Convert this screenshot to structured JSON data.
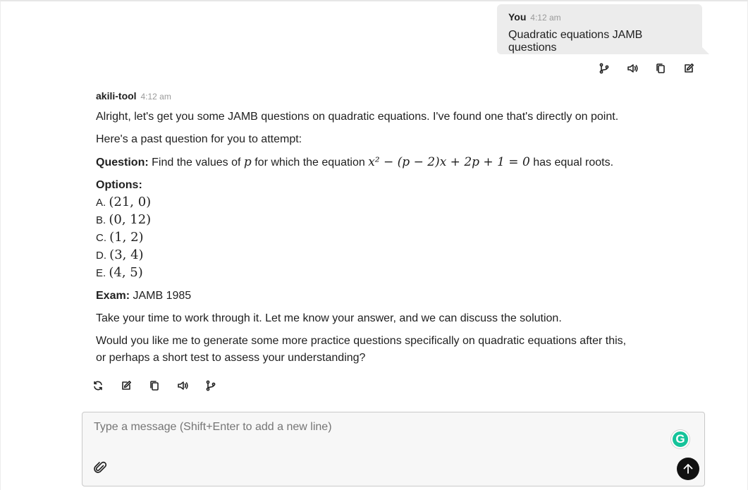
{
  "user_message": {
    "author": "You",
    "time": "4:12 am",
    "text": "Quadratic equations JAMB questions",
    "actions": [
      "branch-icon",
      "speaker-icon",
      "copy-icon",
      "edit-icon"
    ]
  },
  "bot_message": {
    "author": "akili-tool",
    "time": "4:12 am",
    "intro": "Alright, let's get you some JAMB questions on quadratic equations. I've found one that's directly on point.",
    "lead": "Here's a past question for you to attempt:",
    "question_label": "Question:",
    "question_pre": "Find the values of",
    "question_var": "p",
    "question_mid": "for which the equation",
    "question_equation": "x² − (p − 2)x + 2p + 1 = 0",
    "question_post": "has equal roots.",
    "options_label": "Options:",
    "options": [
      {
        "letter": "A.",
        "value": "(21, 0)"
      },
      {
        "letter": "B.",
        "value": "(0, 12)"
      },
      {
        "letter": "C.",
        "value": "(1, 2)"
      },
      {
        "letter": "D.",
        "value": "(3, 4)"
      },
      {
        "letter": "E.",
        "value": "(4, 5)"
      }
    ],
    "exam_label": "Exam:",
    "exam_value": "JAMB 1985",
    "followup": "Take your time to work through it. Let me know your answer, and we can discuss the solution.",
    "offer": "Would you like me to generate some more practice questions specifically on quadratic equations after this, or perhaps a short test to assess your understanding?",
    "actions": [
      "regenerate-icon",
      "edit-icon",
      "copy-icon",
      "speaker-icon",
      "branch-icon"
    ]
  },
  "composer": {
    "placeholder": "Type a message (Shift+Enter to add a new line)",
    "grammarly_letter": "G"
  }
}
